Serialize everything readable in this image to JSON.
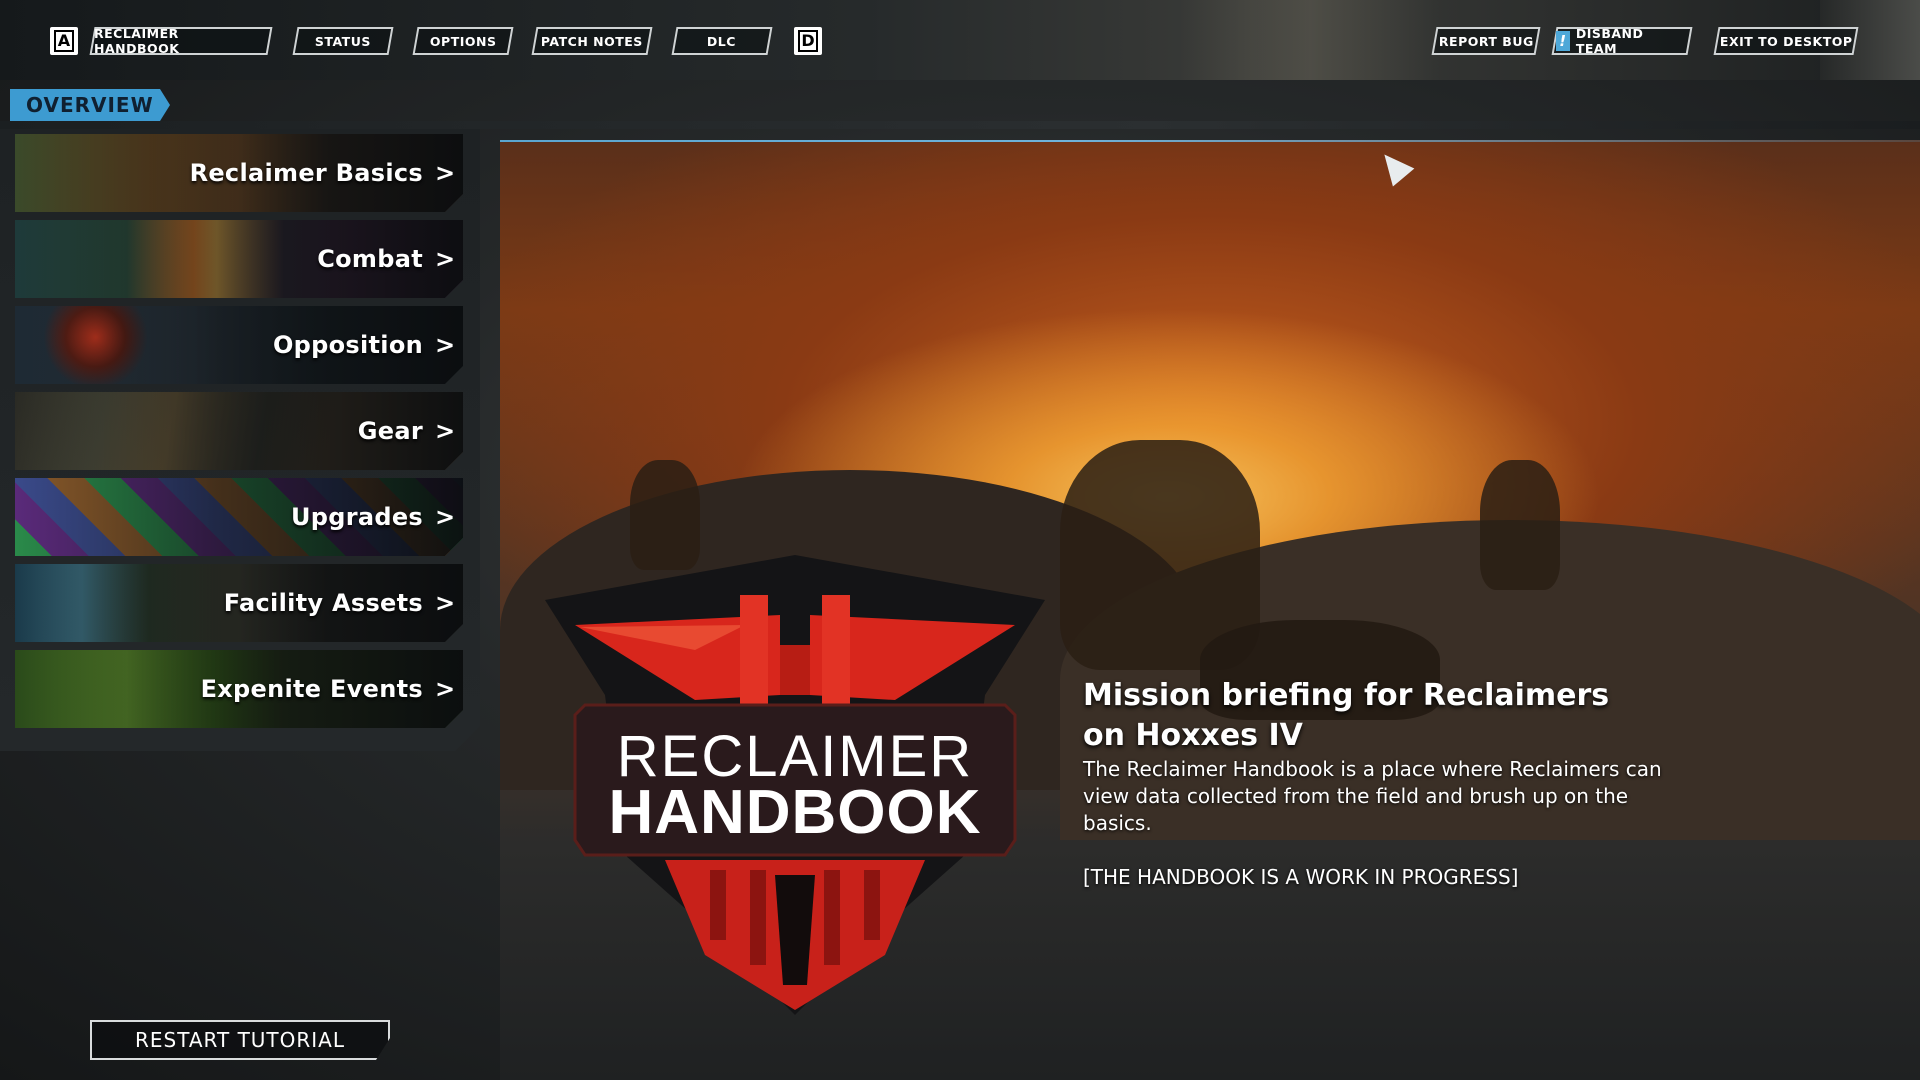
{
  "topbar": {
    "left_key": "A",
    "right_key": "D",
    "tabs": [
      {
        "label": "RECLAIMER HANDBOOK"
      },
      {
        "label": "STATUS"
      },
      {
        "label": "OPTIONS"
      },
      {
        "label": "PATCH NOTES"
      },
      {
        "label": "DLC"
      }
    ],
    "actions": {
      "report_bug": "REPORT BUG",
      "disband_team": "DISBAND TEAM",
      "disband_icon": "!",
      "exit": "EXIT TO DESKTOP"
    }
  },
  "overview": {
    "label": "OVERVIEW"
  },
  "categories": [
    {
      "label": "Reclaimer Basics",
      "chevron": ">"
    },
    {
      "label": "Combat",
      "chevron": ">"
    },
    {
      "label": "Opposition",
      "chevron": ">"
    },
    {
      "label": "Gear",
      "chevron": ">"
    },
    {
      "label": "Upgrades",
      "chevron": ">"
    },
    {
      "label": "Facility Assets",
      "chevron": ">"
    },
    {
      "label": "Expenite Events",
      "chevron": ">"
    }
  ],
  "emblem": {
    "line1": "RECLAIMER",
    "line2": "HANDBOOK"
  },
  "mission": {
    "title": "Mission briefing for Reclaimers on Hoxxes IV",
    "body": "The Reclaimer Handbook is a place where Reclaimers can view data collected from the field and brush up on the basics.",
    "note": "[THE HANDBOOK IS A WORK IN PROGRESS]"
  },
  "restart": {
    "label": "RESTART TUTORIAL"
  },
  "colors": {
    "accent": "#3d9bd1",
    "emblem_red": "#d8261c",
    "emblem_dark": "#1a1a1c"
  }
}
